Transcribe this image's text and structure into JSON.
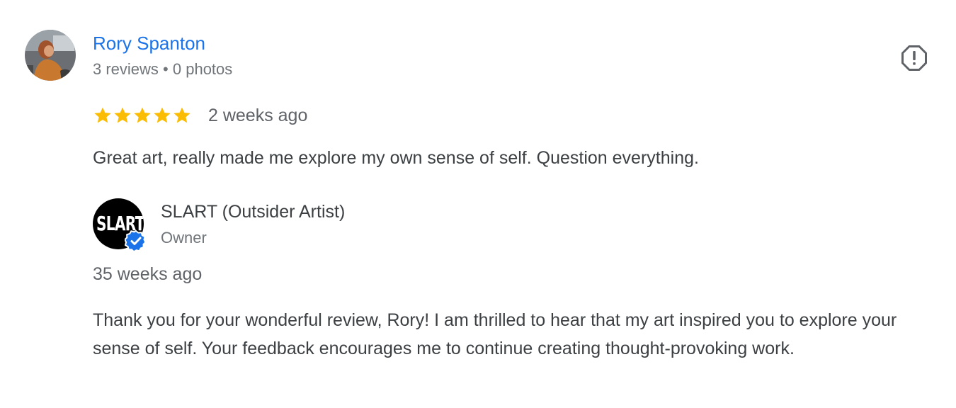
{
  "review": {
    "reviewer": {
      "name": "Rory Spanton",
      "reviews_count": "3 reviews",
      "separator": "•",
      "photos_count": "0 photos",
      "avatar_icon": "user-photo"
    },
    "rating": 5,
    "max_rating": 5,
    "date": "2 weeks ago",
    "text": "Great art, really made me explore my own sense of self. Question everything.",
    "report_icon": "report-flag-icon"
  },
  "owner_response": {
    "logo_text": "SLART",
    "name": "SLART (Outsider Artist)",
    "role": "Owner",
    "verified_icon": "verified-badge-icon",
    "date": "35 weeks ago",
    "text": "Thank you for your wonderful review, Rory! I am thrilled to hear that my art inspired you to explore your sense of self. Your feedback encourages me to continue creating thought-provoking work."
  },
  "colors": {
    "link": "#1a73e8",
    "star": "#fbbc04",
    "text": "#3c4043",
    "muted": "#70757a",
    "verified": "#1a73e8"
  }
}
